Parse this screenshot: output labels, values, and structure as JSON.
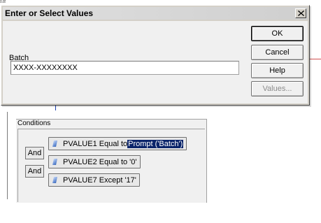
{
  "background": {
    "corner_scrap": "0.85",
    "conditions": {
      "title": "Conditions",
      "rows": [
        {
          "connector": "",
          "prefix": "PVALUE1 Equal to ",
          "selected": "Prompt ('Batch')"
        },
        {
          "connector": "And",
          "prefix": "PVALUE2 Equal to '0'",
          "selected": ""
        },
        {
          "connector": "And",
          "prefix": "PVALUE7 Except '17'",
          "selected": ""
        }
      ]
    }
  },
  "dialog": {
    "title": "Enter or Select Values",
    "close_glyph": "✕",
    "field_label": "Batch",
    "field_value": "XXXX-XXXXXXXX",
    "buttons": {
      "ok": "OK",
      "cancel": "Cancel",
      "help": "Help",
      "values": "Values..."
    }
  },
  "colors": {
    "selection": "#0a246a",
    "dialog_face": "#d4d0c8",
    "panel": "#f0f0f0"
  }
}
